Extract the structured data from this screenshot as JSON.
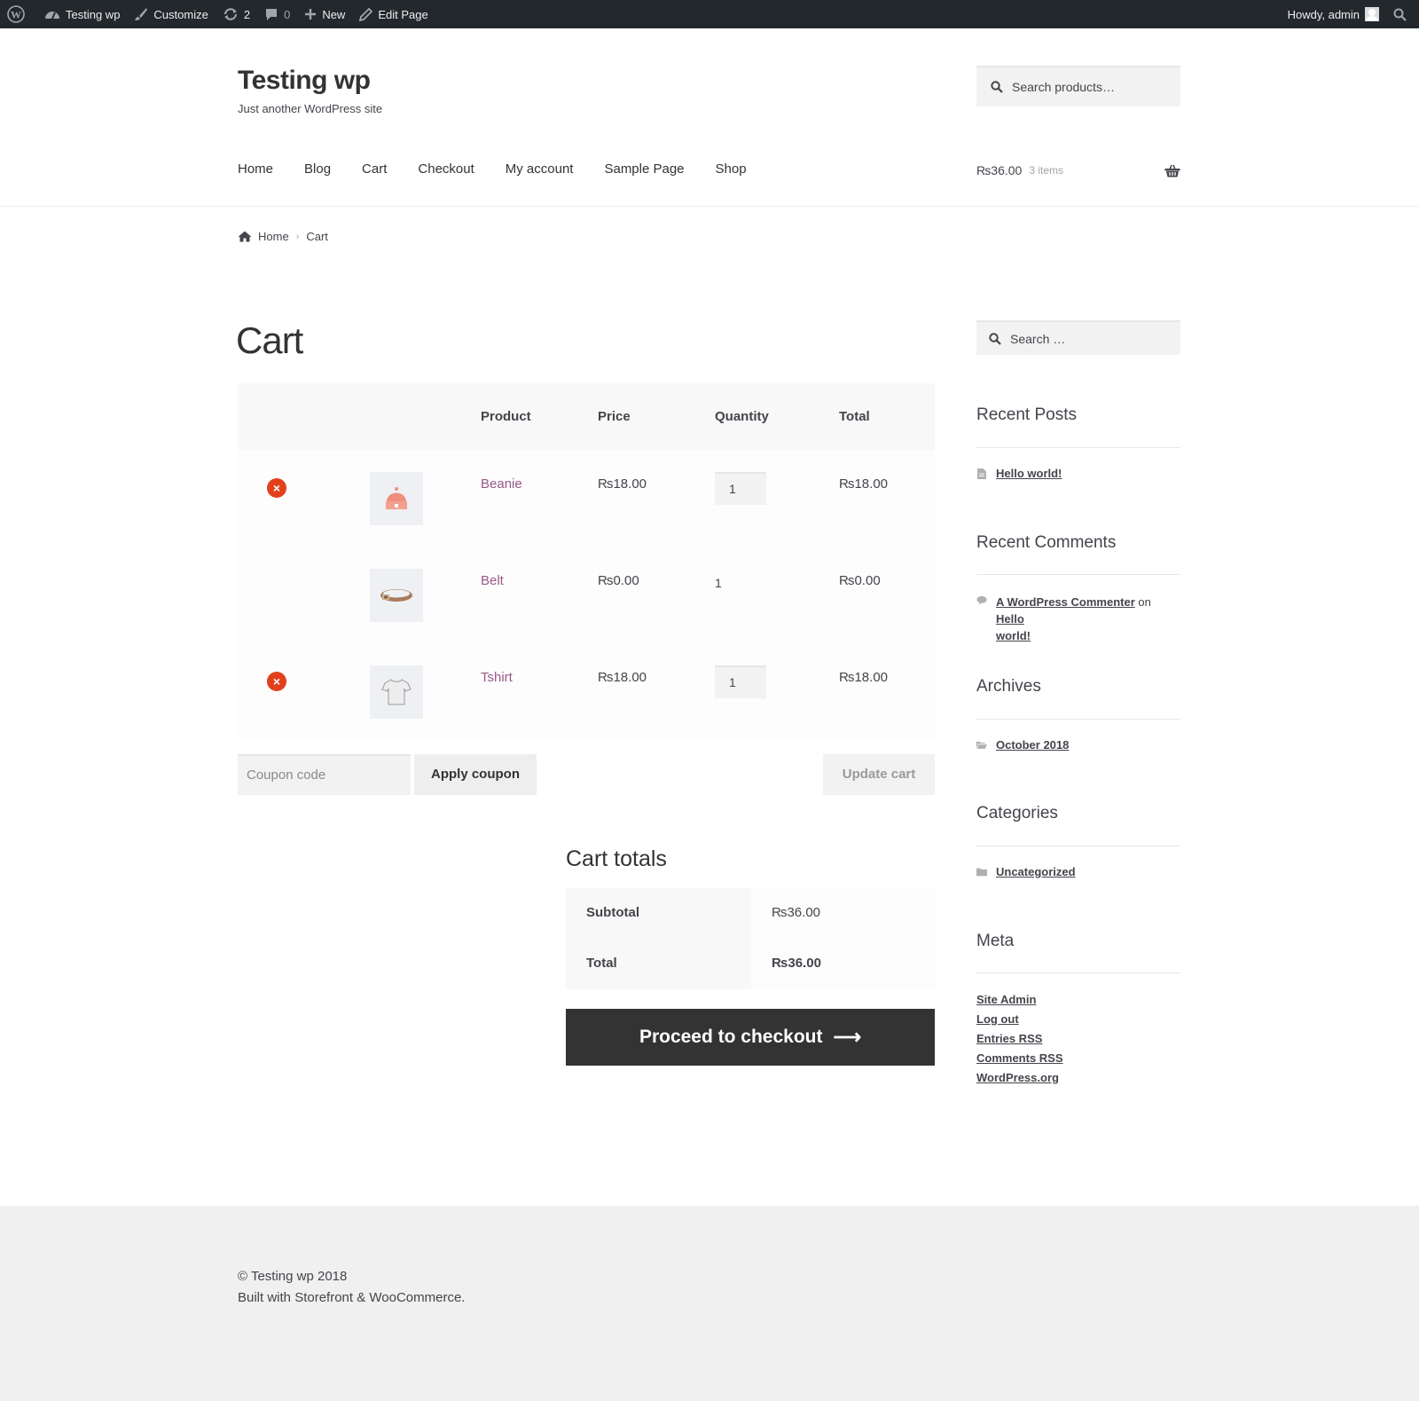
{
  "adminbar": {
    "site": "Testing wp",
    "customize": "Customize",
    "updates": "2",
    "comments": "0",
    "new": "New",
    "edit_page": "Edit Page",
    "howdy": "Howdy, admin"
  },
  "header": {
    "site_title": "Testing wp",
    "tagline": "Just another WordPress site",
    "search_placeholder": "Search products…",
    "nav": [
      "Home",
      "Blog",
      "Cart",
      "Checkout",
      "My account",
      "Sample Page",
      "Shop"
    ],
    "cart_amount": "₨36.00",
    "cart_count": "3 items"
  },
  "breadcrumb": {
    "home": "Home",
    "current": "Cart"
  },
  "cart": {
    "title": "Cart",
    "headers": {
      "product": "Product",
      "price": "Price",
      "quantity": "Quantity",
      "total": "Total"
    },
    "rows": [
      {
        "name": "Beanie",
        "price": "₨18.00",
        "qty": "1",
        "total": "₨18.00",
        "removable": true,
        "thumb": "beanie-icon"
      },
      {
        "name": "Belt",
        "price": "₨0.00",
        "qty": "1",
        "total": "₨0.00",
        "removable": false,
        "thumb": "belt-icon"
      },
      {
        "name": "Tshirt",
        "price": "₨18.00",
        "qty": "1",
        "total": "₨18.00",
        "removable": true,
        "thumb": "tshirt-icon"
      }
    ],
    "coupon_placeholder": "Coupon code",
    "apply_coupon": "Apply coupon",
    "update_cart": "Update cart"
  },
  "totals": {
    "title": "Cart totals",
    "subtotal_label": "Subtotal",
    "subtotal_value": "₨36.00",
    "total_label": "Total",
    "total_value": "₨36.00",
    "checkout": "Proceed to checkout"
  },
  "sidebar": {
    "search_placeholder": "Search …",
    "recent_posts_title": "Recent Posts",
    "recent_post": "Hello world!",
    "recent_comments_title": "Recent Comments",
    "comment_author": "A WordPress Commenter",
    "comment_on": "on",
    "comment_post_1": "Hello",
    "comment_post_2": "world!",
    "archives_title": "Archives",
    "archive": "October 2018",
    "categories_title": "Categories",
    "category": "Uncategorized",
    "meta_title": "Meta",
    "meta_links": [
      "Site Admin",
      "Log out",
      "Entries RSS",
      "Comments RSS",
      "WordPress.org"
    ]
  },
  "footer": {
    "copyright": "© Testing wp 2018",
    "built": "Built with Storefront & WooCommerce."
  },
  "colors": {
    "accent": "#96588a",
    "remove": "#e2401c",
    "dark": "#333333",
    "adminbar": "#23282d"
  }
}
